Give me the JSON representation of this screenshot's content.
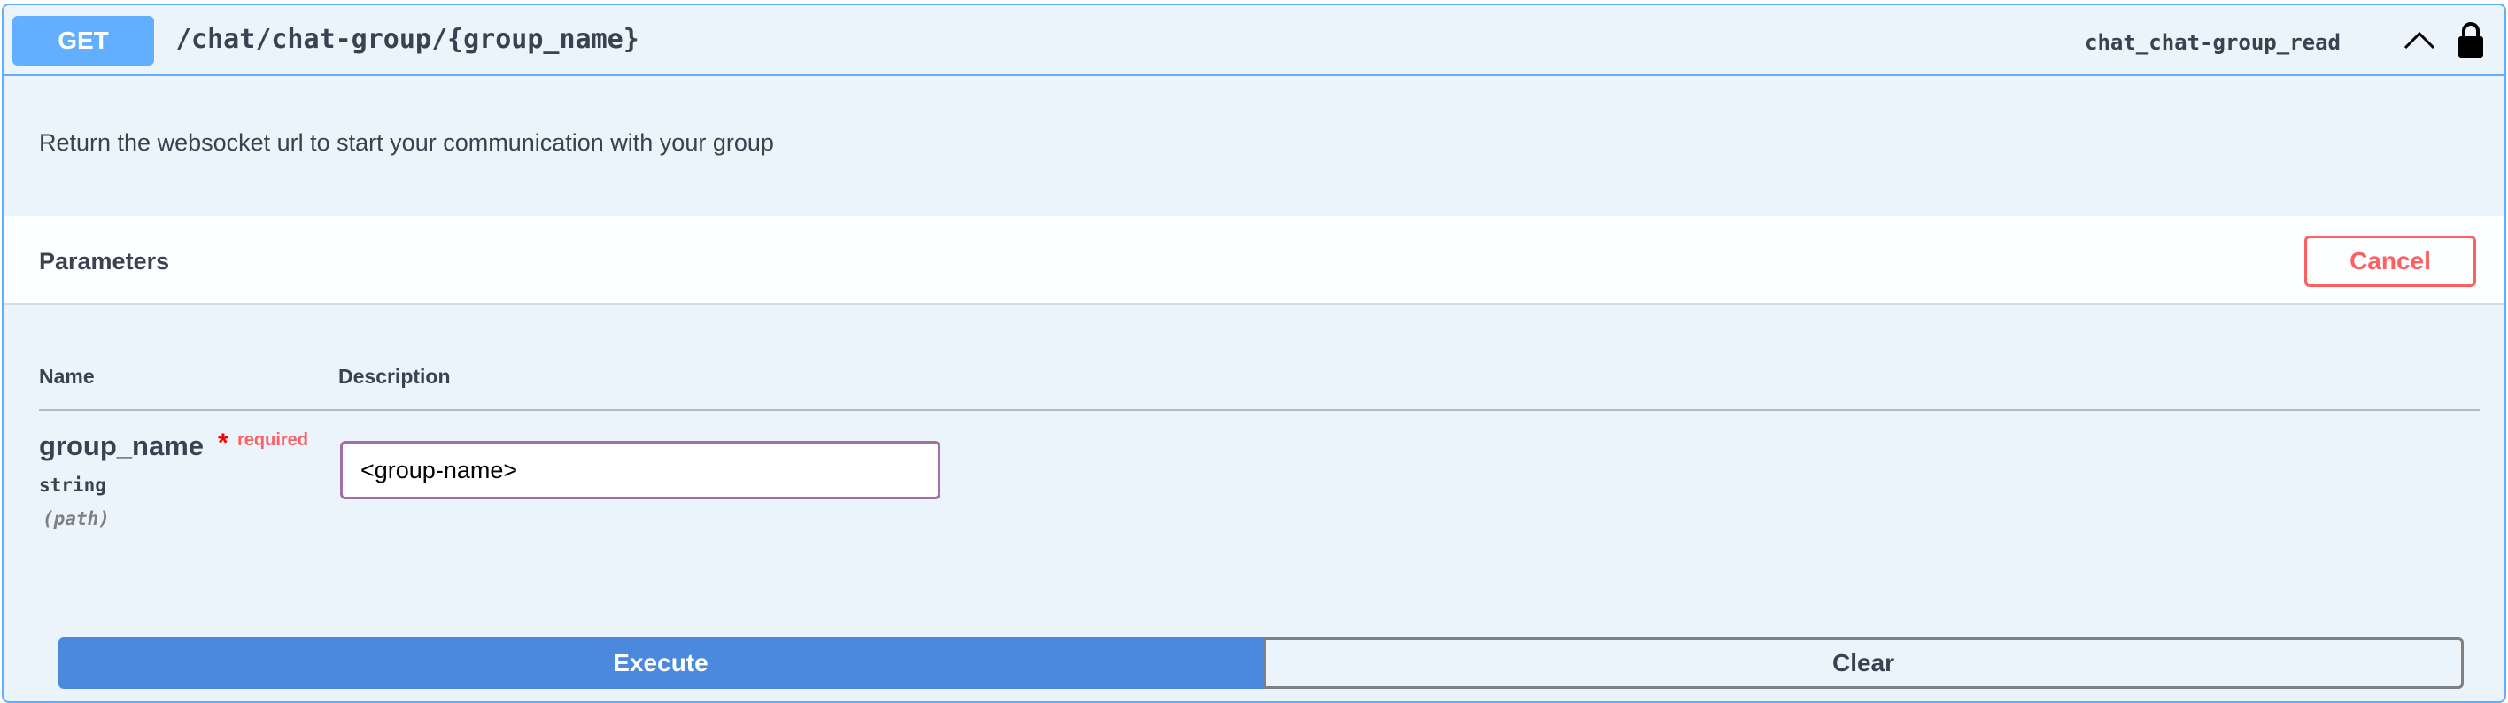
{
  "operation": {
    "method": "GET",
    "path": "/chat/chat-group/{group_name}",
    "operation_id": "chat_chat-group_read",
    "description": "Return the websocket url to start your communication with your group",
    "collapse_icon": "chevron-up-icon",
    "auth_icon": "lock-icon"
  },
  "parameters": {
    "title": "Parameters",
    "cancel_label": "Cancel",
    "columns": {
      "name": "Name",
      "description": "Description"
    },
    "items": [
      {
        "name": "group_name",
        "required_marker": "*",
        "required_label": "required",
        "type": "string",
        "location": "(path)",
        "value": "<group-name>"
      }
    ]
  },
  "actions": {
    "execute_label": "Execute",
    "clear_label": "Clear"
  },
  "colors": {
    "get_accent": "#61affe",
    "cancel": "#ff6060",
    "execute": "#4a89dc",
    "input_border": "#a46fa8"
  }
}
